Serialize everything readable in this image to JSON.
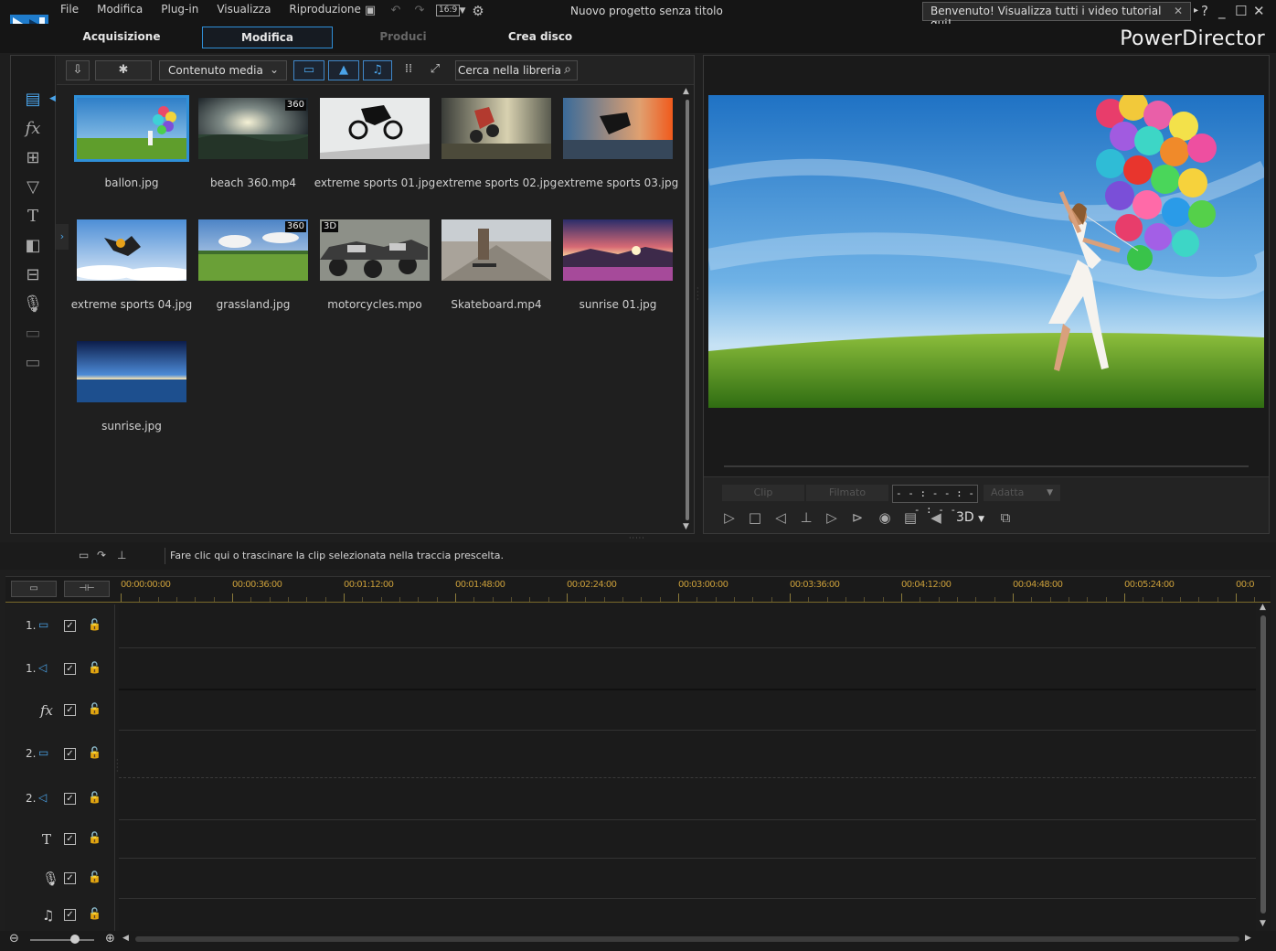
{
  "menu": {
    "items": [
      "File",
      "Modifica",
      "Plug-in",
      "Visualizza",
      "Riproduzione"
    ],
    "aspect_ratio": "16:9"
  },
  "project_title": "Nuovo progetto senza titolo",
  "welcome_banner": "Benvenuto! Visualizza tutti i video tutorial qui!",
  "window_controls": {
    "help": "?",
    "minimize": "_",
    "maximize": "☐",
    "close": "✕"
  },
  "modes": {
    "capture": "Acquisizione",
    "edit": "Modifica",
    "produce": "Produci",
    "disc": "Crea disco"
  },
  "brand": "PowerDirector",
  "library": {
    "content_dropdown": "Contenuto media",
    "search_placeholder": "Cerca nella libreria",
    "items": [
      {
        "label": "ballon.jpg",
        "badge": ""
      },
      {
        "label": "beach 360.mp4",
        "badge": "360"
      },
      {
        "label": "extreme sports 01.jpg",
        "badge": ""
      },
      {
        "label": "extreme sports 02.jpg",
        "badge": ""
      },
      {
        "label": "extreme sports 03.jpg",
        "badge": ""
      },
      {
        "label": "extreme sports 04.jpg",
        "badge": ""
      },
      {
        "label": "grassland.jpg",
        "badge": "360"
      },
      {
        "label": "motorcycles.mpo",
        "badge": "3D"
      },
      {
        "label": "Skateboard.mp4",
        "badge": ""
      },
      {
        "label": "sunrise 01.jpg",
        "badge": ""
      },
      {
        "label": "sunrise.jpg",
        "badge": ""
      }
    ]
  },
  "preview": {
    "clip_label": "Clip",
    "movie_label": "Filmato",
    "timecode": "- - : - - : - - : - -",
    "fit_label": "Adatta",
    "threed_label": "3D"
  },
  "instruction": "Fare clic qui o trascinare la clip selezionata nella traccia prescelta.",
  "timeline": {
    "ticks": [
      "00:00:00:00",
      "00:00:36:00",
      "00:01:12:00",
      "00:01:48:00",
      "00:02:24:00",
      "00:03:00:00",
      "00:03:36:00",
      "00:04:12:00",
      "00:04:48:00",
      "00:05:24:00",
      "00:0"
    ],
    "tracks": [
      {
        "num": "1.",
        "icon": "video-track-icon"
      },
      {
        "num": "1.",
        "icon": "audio-track-icon"
      },
      {
        "num": "",
        "icon": "fx-track-icon"
      },
      {
        "num": "2.",
        "icon": "video-track-icon"
      },
      {
        "num": "2.",
        "icon": "audio-track-icon"
      },
      {
        "num": "",
        "icon": "title-track-icon"
      },
      {
        "num": "",
        "icon": "voice-track-icon"
      },
      {
        "num": "",
        "icon": "music-track-icon"
      }
    ]
  },
  "colors": {
    "accent": "#2f8fd8",
    "ruler_text": "#c99e3a"
  }
}
